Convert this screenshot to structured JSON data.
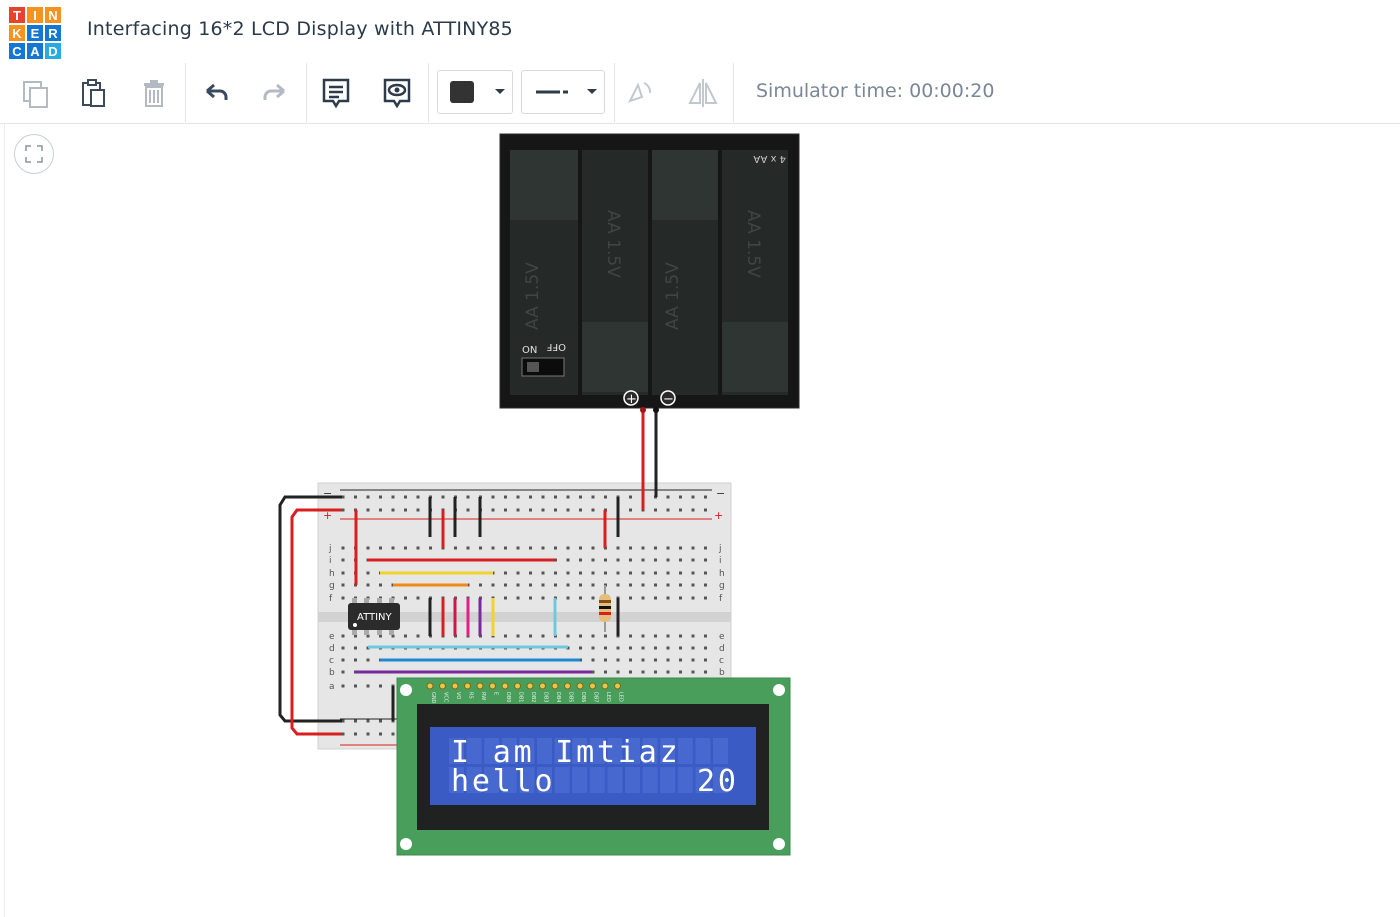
{
  "app": {
    "logo_letters": [
      "T",
      "I",
      "N",
      "K",
      "E",
      "R",
      "C",
      "A",
      "D"
    ],
    "logo_colors": [
      "#e8412c",
      "#f6921e",
      "#f6921e",
      "#f6921e",
      "#1477d4",
      "#1477d4",
      "#1477d4",
      "#1477d4",
      "#29abe2"
    ],
    "title": "Interfacing 16*2 LCD Display with ATTINY85"
  },
  "toolbar": {
    "buttons": [
      "copy-icon",
      "paste-icon",
      "delete-icon",
      "undo-icon",
      "redo-icon",
      "notes-icon",
      "view-icon",
      "rotate-icon",
      "flip-icon"
    ],
    "color_swatch": "#333333",
    "simulator_time": "Simulator time: 00:00:20"
  },
  "battery": {
    "label": "4 x AA",
    "cell_label": "AA 1.5V",
    "switch_on": "ON",
    "switch_off": "OFF",
    "plus": "+",
    "minus": "−"
  },
  "breadboard": {
    "rail_plus": "+",
    "rail_minus": "−",
    "rows_top": [
      "j",
      "i",
      "h",
      "g",
      "f"
    ],
    "rows_bottom": [
      "e",
      "d",
      "c",
      "b",
      "a"
    ]
  },
  "chip": {
    "label": "ATTINY"
  },
  "lcd": {
    "line1": "I am Imtiaz",
    "line2": "hello",
    "line2_value": "20",
    "pin_labels": [
      "GND",
      "VCC",
      "VO",
      "RS",
      "RW",
      "E",
      "DB0",
      "DB1",
      "DB2",
      "DB3",
      "DB4",
      "DB5",
      "DB6",
      "DB7",
      "LED",
      "LED"
    ]
  },
  "colors": {
    "breadboard": "#e6e6e6",
    "battery": "#111111",
    "lcd_board": "#4a9e5c",
    "lcd_screen": "#3a5bc4",
    "wire_red": "#d81e1e",
    "wire_black": "#222222"
  }
}
